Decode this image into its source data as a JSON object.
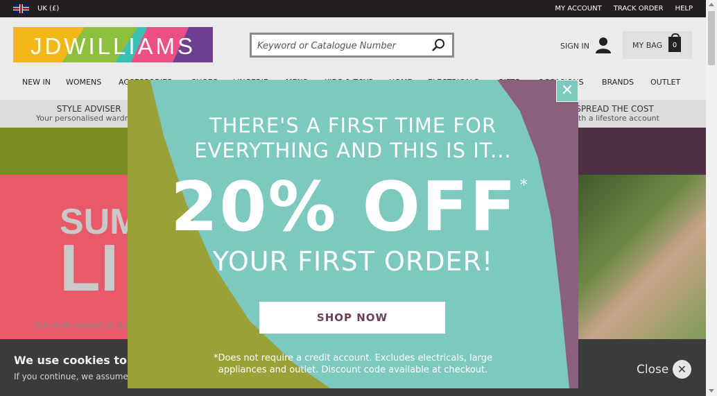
{
  "topbar": {
    "region": "UK (£)",
    "links": [
      "MY ACCOUNT",
      "TRACK ORDER",
      "HELP"
    ]
  },
  "header": {
    "logo_text": "JDWILLIAMS",
    "search_placeholder": "Keyword or Catalogue Number",
    "sign_in": "SIGN IN",
    "bag_label": "MY BAG",
    "bag_count": "0"
  },
  "nav": {
    "items": [
      "NEW IN",
      "WOMENS",
      "ACCESSORIES",
      "SHOES",
      "LINGERIE",
      "MENS",
      "KIDS & TOYS",
      "HOME",
      "ELECTRICALS",
      "GIFTS",
      "OCCASIONS",
      "BRANDS",
      "OUTLET"
    ]
  },
  "promo": {
    "left_title": "STYLE ADVISER",
    "left_sub": "Your personalised wardrobe",
    "right_title": "SPREAD THE COST",
    "right_sub": "with a lifestore account"
  },
  "hero": {
    "big1": "SUM",
    "big2": "LI",
    "text": "Our new advert is out"
  },
  "cookies": {
    "title": "We use cookies to give you the best experience",
    "sub": "If you continue, we assume that you are happy to receive all cookies",
    "close_label": "Close"
  },
  "modal": {
    "headline_1": "THERE'S A FIRST TIME FOR",
    "headline_2": "EVERYTHING AND THIS IS IT...",
    "discount": "20% OFF",
    "asterisk": "*",
    "subhead": "YOUR FIRST ORDER!",
    "cta": "SHOP NOW",
    "fine_print": "*Does not require a credit account. Excludes electricals, large appliances and outlet. Discount code available at checkout.",
    "close_symbol": "✕"
  }
}
